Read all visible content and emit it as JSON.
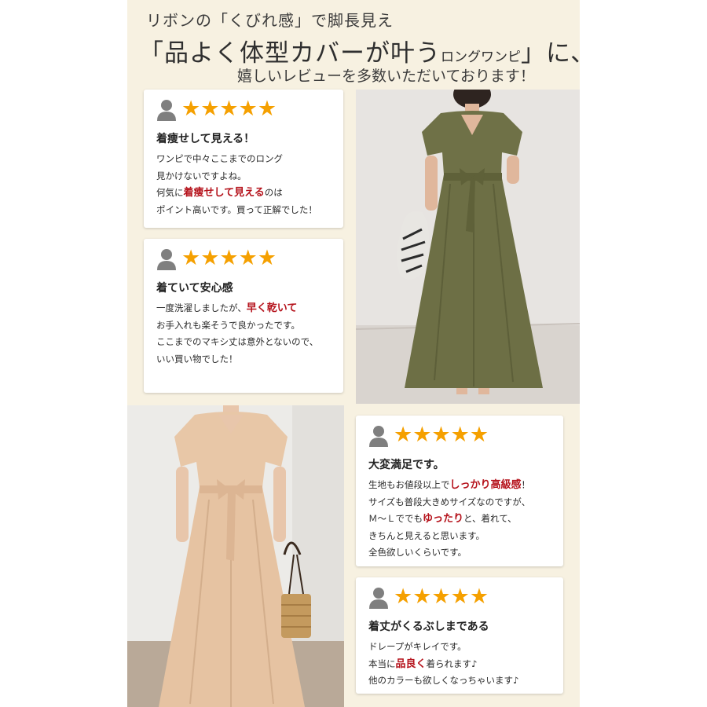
{
  "heading": {
    "line1": "リボンの「くびれ感」で脚長見え",
    "line2_big": "「品よく体型カバーが叶う",
    "line2_small": "ロングワンピ",
    "line2_end": "」に、",
    "line3": "嬉しいレビューを多数いただいております！"
  },
  "reviews": [
    {
      "rating": "★★★★★",
      "title": "着痩せして見える！",
      "lines": [
        [
          {
            "t": "ワンピで中々ここまでのロング"
          }
        ],
        [
          {
            "t": "見かけないですよね。"
          }
        ],
        [
          {
            "t": "何気に"
          },
          {
            "t": "着痩せして見える",
            "hl": true
          },
          {
            "t": "のは"
          }
        ],
        [
          {
            "t": "ポイント高いです。買って正解でした！"
          }
        ]
      ]
    },
    {
      "rating": "★★★★★",
      "title": "着ていて安心感",
      "lines": [
        [
          {
            "t": "一度洗濯しましたが、"
          },
          {
            "t": "早く乾いて",
            "hl": true
          }
        ],
        [
          {
            "t": "お手入れも楽そうで良かったです。"
          }
        ],
        [
          {
            "t": "ここまでのマキシ丈は意外とないので、"
          }
        ],
        [
          {
            "t": "いい買い物でした！"
          }
        ]
      ]
    },
    {
      "rating": "★★★★★",
      "title": "大変満足です。",
      "lines": [
        [
          {
            "t": "生地もお値段以上で"
          },
          {
            "t": "しっかり高級感",
            "hl": true
          },
          {
            "t": "！"
          }
        ],
        [
          {
            "t": "サイズも普段大きめサイズなのですが、"
          }
        ],
        [
          {
            "t": "Ｍ～Ｌででも"
          },
          {
            "t": "ゆったり",
            "hl": true
          },
          {
            "t": "と、着れて、"
          }
        ],
        [
          {
            "t": "きちんと見えると思います。"
          }
        ],
        [
          {
            "t": "全色欲しいくらいです。"
          }
        ]
      ]
    },
    {
      "rating": "★★★★★",
      "title": "着丈がくるぶしまである",
      "lines": [
        [
          {
            "t": "ドレープがキレイです。"
          }
        ],
        [
          {
            "t": "本当に"
          },
          {
            "t": "品良く",
            "hl": true
          },
          {
            "t": "着られます♪"
          }
        ],
        [
          {
            "t": "他のカラーも欲しくなっちゃいます♪"
          }
        ]
      ]
    }
  ],
  "colors": {
    "background_panel": "#f7f1e1",
    "star": "#f5a000",
    "highlight": "#b5121b",
    "khaki_dress": "#6f7147",
    "beige_dress": "#e8c7a7"
  },
  "photos": [
    {
      "icon": "model-photo-khaki-dress"
    },
    {
      "icon": "model-photo-beige-dress"
    }
  ]
}
